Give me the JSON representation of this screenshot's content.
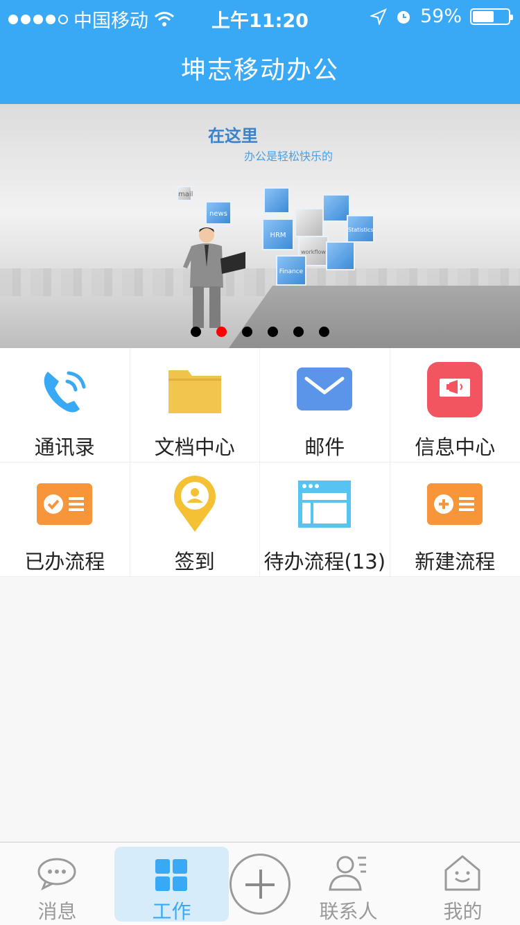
{
  "status": {
    "carrier": "中国移动",
    "time": "上午11:20",
    "battery": "59%",
    "battery_level": 0.59
  },
  "header": {
    "title": "坤志移动办公"
  },
  "banner": {
    "headline": "在这里",
    "subline": "办公是轻松快乐的",
    "cube_labels": [
      "HRM",
      "news",
      "Finance",
      "workflow",
      "Statistics",
      "mail"
    ],
    "page_count": 6,
    "active_page": 1
  },
  "menu": [
    {
      "label": "通讯录",
      "icon": "phone-icon"
    },
    {
      "label": "文档中心",
      "icon": "folder-icon"
    },
    {
      "label": "邮件",
      "icon": "mail-icon"
    },
    {
      "label": "信息中心",
      "icon": "megaphone-icon"
    },
    {
      "label": "已办流程",
      "icon": "done-process-icon"
    },
    {
      "label": "签到",
      "icon": "location-pin-icon"
    },
    {
      "label": "待办流程(13)",
      "icon": "todo-window-icon"
    },
    {
      "label": "新建流程",
      "icon": "new-process-icon"
    }
  ],
  "tabs": [
    {
      "label": "消息",
      "icon": "chat-icon"
    },
    {
      "label": "工作",
      "icon": "grid-icon",
      "active": true
    },
    {
      "label": "",
      "icon": "plus-icon"
    },
    {
      "label": "联系人",
      "icon": "contact-icon"
    },
    {
      "label": "我的",
      "icon": "home-face-icon"
    }
  ],
  "colors": {
    "primary": "#3aa9f5",
    "folder": "#f0c44c",
    "mail": "#5b95e9",
    "info": "#f25560",
    "orange": "#f7953a",
    "pin": "#f4c135",
    "window": "#55c4f0",
    "pager_active": "#ff0000"
  }
}
